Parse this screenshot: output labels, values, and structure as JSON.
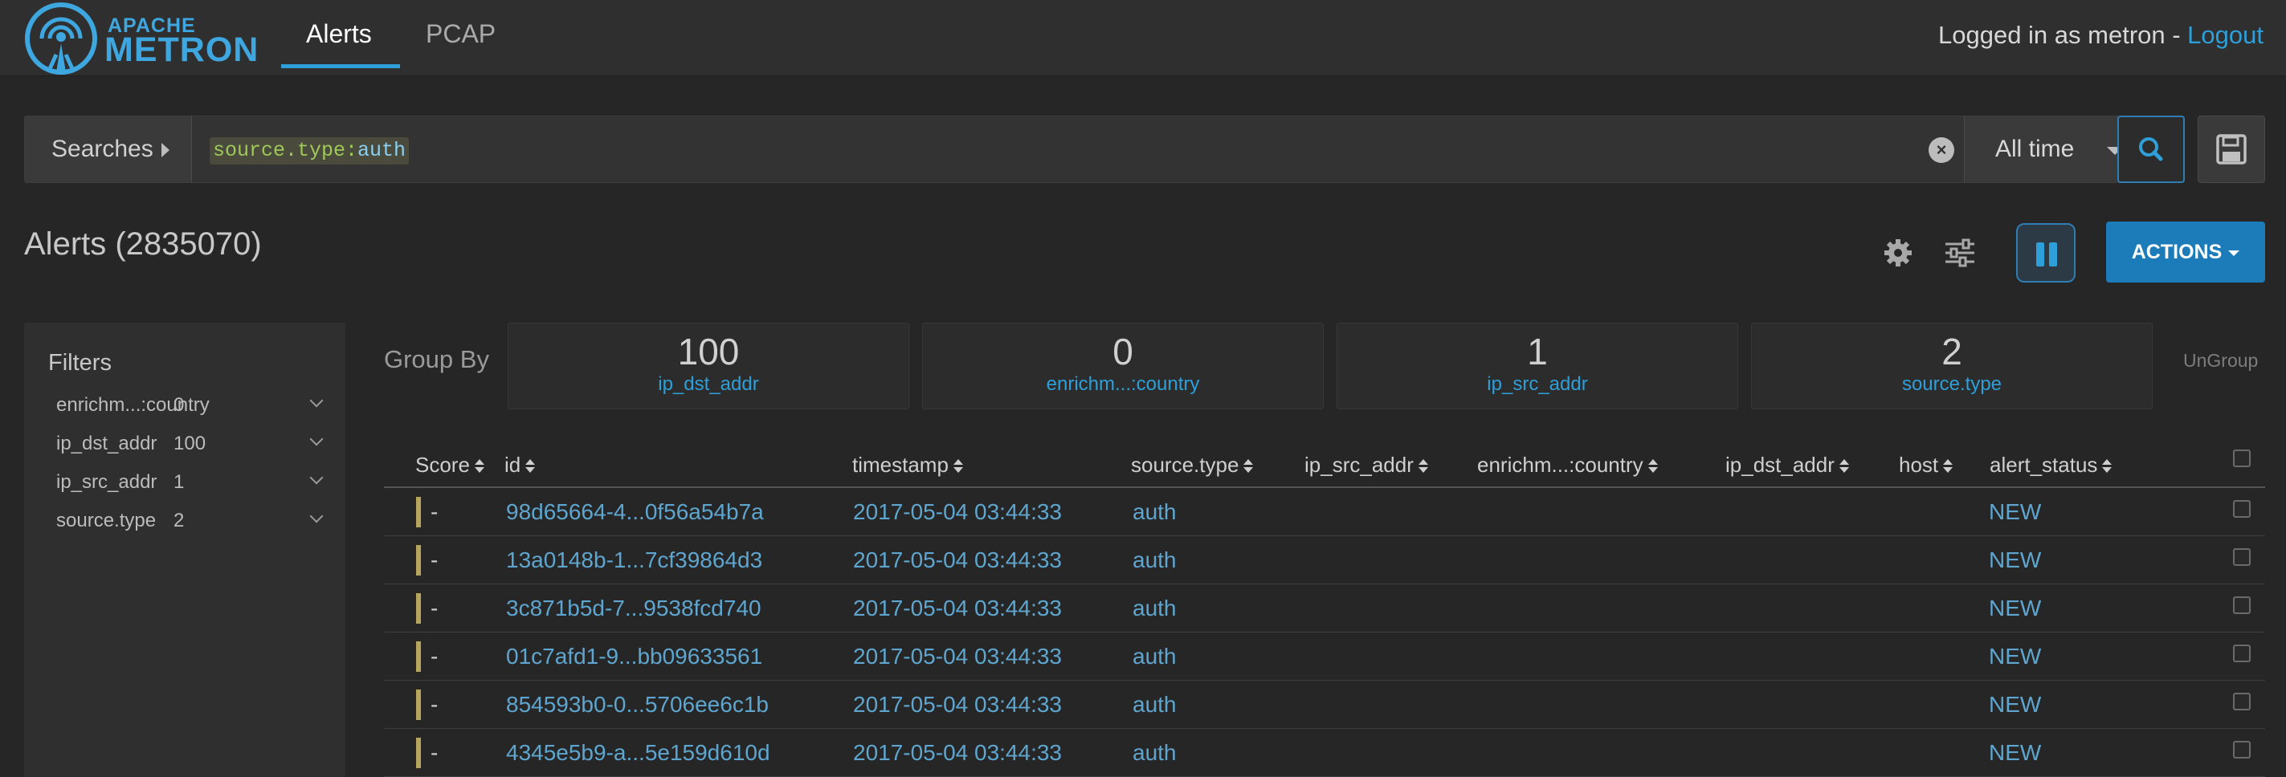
{
  "brand": {
    "line1": "APACHE",
    "line2": "METRON"
  },
  "nav": {
    "tabs": [
      "Alerts",
      "PCAP"
    ],
    "active": "Alerts"
  },
  "session": {
    "prefix": "Logged in as metron - ",
    "logout": "Logout"
  },
  "search": {
    "searches_label": "Searches",
    "query_key": "source.type:",
    "query_value": "auth",
    "time_range": "All time"
  },
  "alerts": {
    "title": "Alerts (2835070)"
  },
  "actions": {
    "label": "ACTIONS"
  },
  "filters": {
    "title": "Filters",
    "items": [
      {
        "name": "enrichm...:country",
        "count": "0"
      },
      {
        "name": "ip_dst_addr",
        "count": "100"
      },
      {
        "name": "ip_src_addr",
        "count": "1"
      },
      {
        "name": "source.type",
        "count": "2"
      }
    ]
  },
  "group_by": {
    "label": "Group By",
    "ungroup": "UnGroup",
    "cards": [
      {
        "count": "100",
        "name": "ip_dst_addr"
      },
      {
        "count": "0",
        "name": "enrichm...:country"
      },
      {
        "count": "1",
        "name": "ip_src_addr"
      },
      {
        "count": "2",
        "name": "source.type"
      }
    ]
  },
  "table": {
    "columns": [
      "Score",
      "id",
      "timestamp",
      "source.type",
      "ip_src_addr",
      "enrichm...:country",
      "ip_dst_addr",
      "host",
      "alert_status"
    ],
    "rows": [
      {
        "score": "-",
        "id": "98d65664-4...0f56a54b7a",
        "timestamp": "2017-05-04 03:44:33",
        "source_type": "auth",
        "alert_status": "NEW"
      },
      {
        "score": "-",
        "id": "13a0148b-1...7cf39864d3",
        "timestamp": "2017-05-04 03:44:33",
        "source_type": "auth",
        "alert_status": "NEW"
      },
      {
        "score": "-",
        "id": "3c871b5d-7...9538fcd740",
        "timestamp": "2017-05-04 03:44:33",
        "source_type": "auth",
        "alert_status": "NEW"
      },
      {
        "score": "-",
        "id": "01c7afd1-9...bb09633561",
        "timestamp": "2017-05-04 03:44:33",
        "source_type": "auth",
        "alert_status": "NEW"
      },
      {
        "score": "-",
        "id": "854593b0-0...5706ee6c1b",
        "timestamp": "2017-05-04 03:44:33",
        "source_type": "auth",
        "alert_status": "NEW"
      },
      {
        "score": "-",
        "id": "4345e5b9-a...5e159d610d",
        "timestamp": "2017-05-04 03:44:33",
        "source_type": "auth",
        "alert_status": "NEW"
      }
    ]
  },
  "colors": {
    "accent": "#2e9fd8",
    "primary_button": "#1b7cb9",
    "score_bar": "#b8a55d"
  }
}
